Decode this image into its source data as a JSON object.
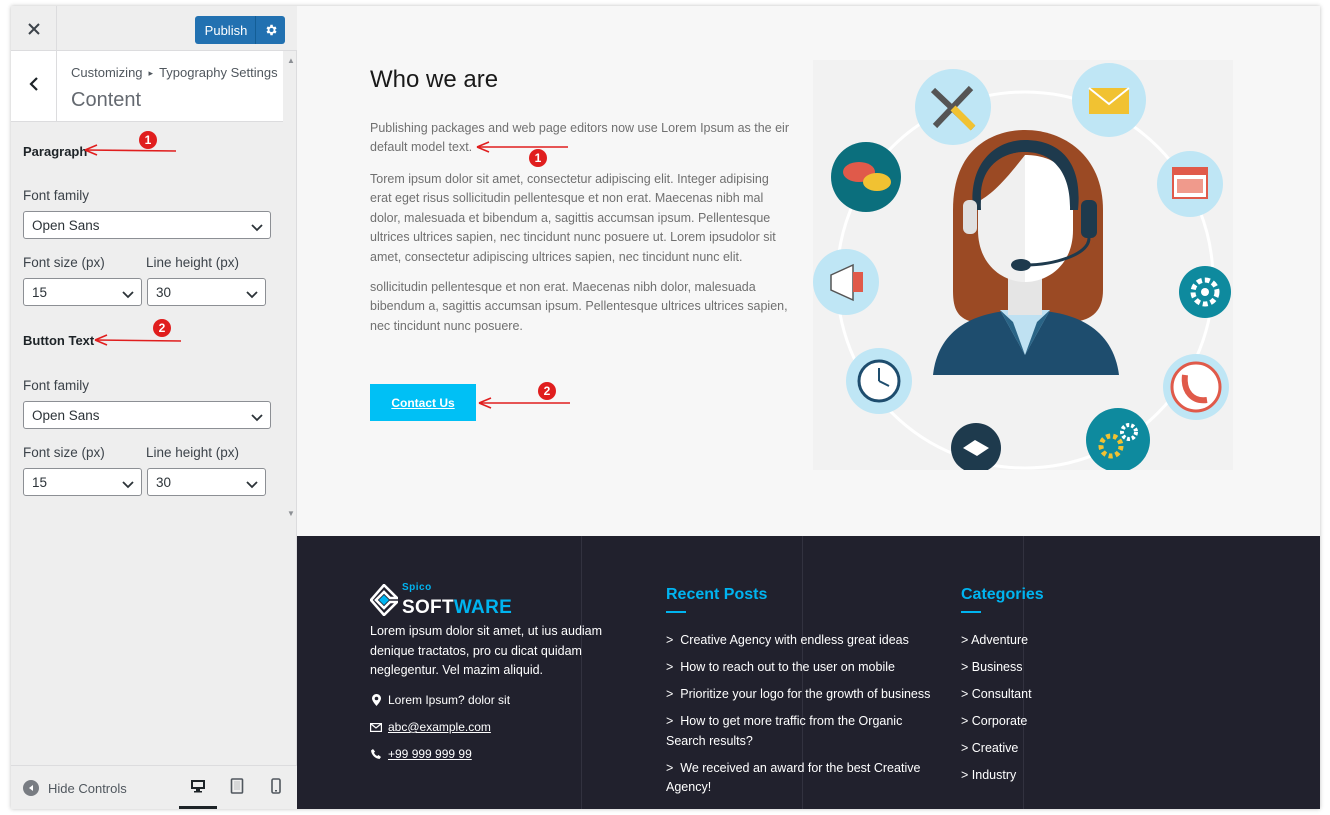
{
  "customizer": {
    "close_icon": "close-icon",
    "publish_label": "Publish",
    "breadcrumb_root": "Customizing",
    "breadcrumb_sep": "▸",
    "breadcrumb_section": "Typography Settings",
    "section_title": "Content",
    "groups": [
      {
        "heading": "Paragraph",
        "font_family_label": "Font family",
        "font_family_value": "Open Sans",
        "font_size_label": "Font size (px)",
        "font_size_value": "15",
        "line_height_label": "Line height (px)",
        "line_height_value": "30"
      },
      {
        "heading": "Button Text",
        "font_family_label": "Font family",
        "font_family_value": "Open Sans",
        "font_size_label": "Font size (px)",
        "font_size_value": "15",
        "line_height_label": "Line height (px)",
        "line_height_value": "30"
      }
    ],
    "hide_controls_label": "Hide Controls",
    "devices": [
      "desktop-icon",
      "tablet-icon",
      "mobile-icon"
    ]
  },
  "annotations": {
    "marker_1": "1",
    "marker_2": "2",
    "color": "#e01e1e"
  },
  "about": {
    "title": "Who we are",
    "paragraphs": [
      "Publishing packages and web page editors now use Lorem Ipsum as the eir default model text.",
      "Torem ipsum dolor sit amet, consectetur adipiscing elit. Integer adipising erat eget risus sollicitudin pellentesque et non erat. Maecenas nibh mal dolor, malesuada et bibendum a, sagittis accumsan ipsum. Pellentesque ultrices ultrices sapien, nec tincidunt nunc posuere ut. Lorem ipsudolor sit amet, consectetur adipiscing ultrices sapien, nec tincidunt nunc elit.",
      "sollicitudin pellentesque et non erat. Maecenas nibh dolor, malesuada bibendum a, sagittis accumsan ipsum. Pellentesque ultrices ultrices sapien, nec tincidunt nunc posuere."
    ],
    "button_label": "Contact Us",
    "illustration": "customer-support-illustration"
  },
  "footer": {
    "brand_small": "Spico",
    "brand_soft": "SOFT",
    "brand_ware": "WARE",
    "description": "Lorem ipsum dolor sit amet, ut ius audiam denique  tractatos, pro cu dicat quidam neglegentur. Vel mazim aliquid.",
    "address": "Lorem Ipsum? dolor sit",
    "email": "abc@example.com",
    "phone": "+99 999 999 99",
    "recent_posts_title": "Recent Posts",
    "recent_posts": [
      "Creative Agency with endless great ideas",
      "How to reach out to the user on mobile",
      "Prioritize your logo for the growth of business",
      "How to get more traffic from the Organic Search results?",
      "We received an award for the best Creative Agency!"
    ],
    "categories_title": "Categories",
    "categories": [
      "Adventure",
      "Business",
      "Consultant",
      "Corporate",
      "Creative",
      "Industry"
    ]
  },
  "colors": {
    "publish": "#2271b1",
    "accent": "#00c0f5",
    "footer_bg": "#21212d",
    "annotation": "#e01e1e"
  }
}
